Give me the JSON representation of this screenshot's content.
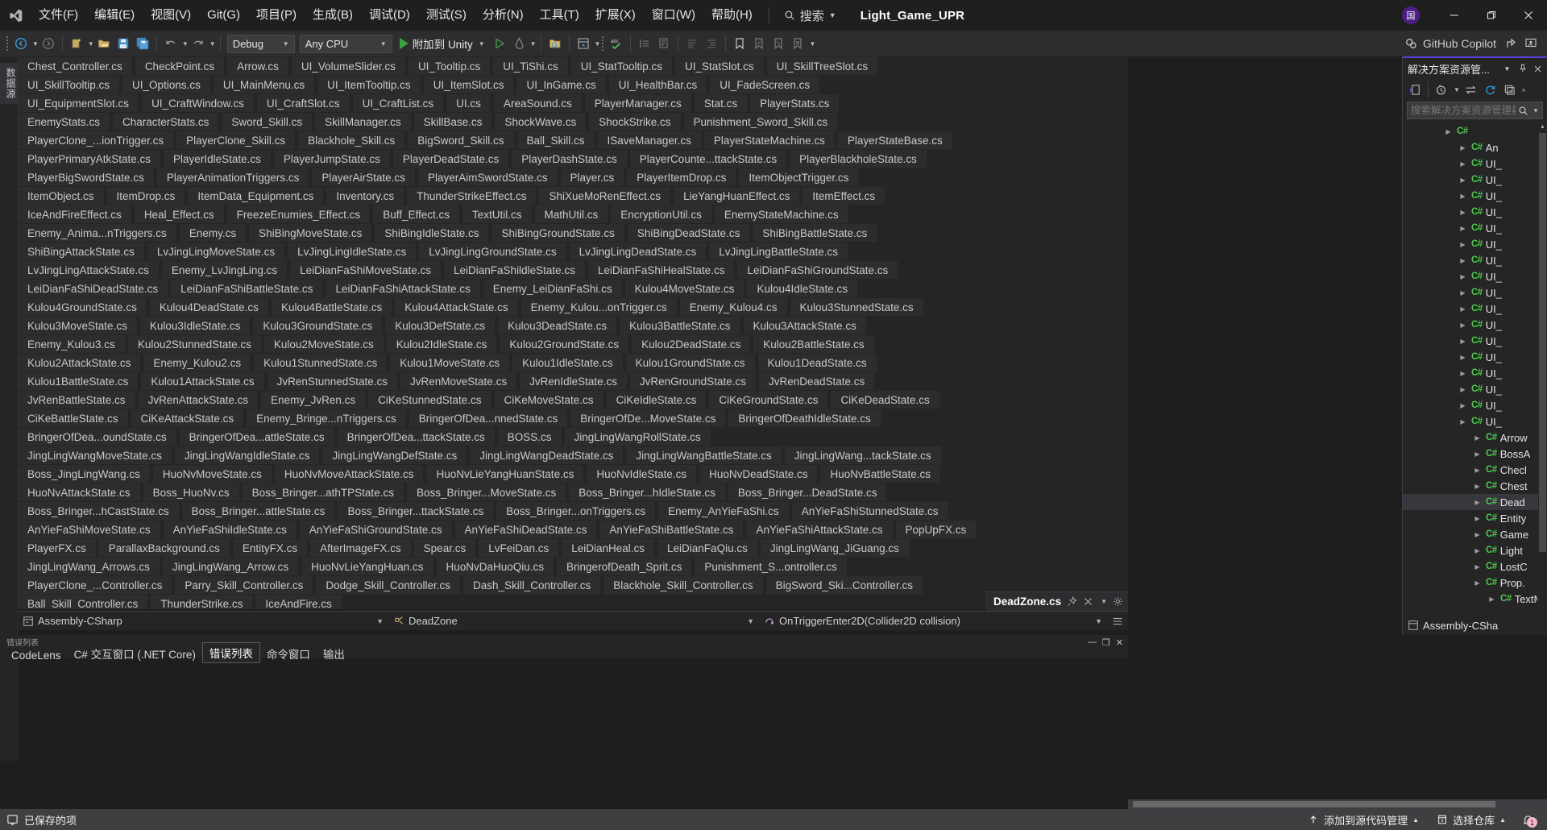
{
  "window": {
    "app": "Visual Studio",
    "solution_title": "Light_Game_UPR",
    "account_initial": "国",
    "minimize": "—",
    "restore": "❐",
    "close": "✕"
  },
  "menu": {
    "items": [
      {
        "label": "文件(F)",
        "name": "menu-file"
      },
      {
        "label": "编辑(E)",
        "name": "menu-edit"
      },
      {
        "label": "视图(V)",
        "name": "menu-view"
      },
      {
        "label": "Git(G)",
        "name": "menu-git"
      },
      {
        "label": "项目(P)",
        "name": "menu-project"
      },
      {
        "label": "生成(B)",
        "name": "menu-build"
      },
      {
        "label": "调试(D)",
        "name": "menu-debug"
      },
      {
        "label": "测试(S)",
        "name": "menu-test"
      },
      {
        "label": "分析(N)",
        "name": "menu-analyze"
      },
      {
        "label": "工具(T)",
        "name": "menu-tools"
      },
      {
        "label": "扩展(X)",
        "name": "menu-extensions"
      },
      {
        "label": "窗口(W)",
        "name": "menu-window"
      },
      {
        "label": "帮助(H)",
        "name": "menu-help"
      }
    ],
    "search_label": "搜索"
  },
  "copilot": {
    "label": "GitHub Copilot"
  },
  "toolbar": {
    "configuration": "Debug",
    "platform": "Any CPU",
    "run_label": "附加到 Unity"
  },
  "left_dock": {
    "data_sources": "数据源"
  },
  "tab_well": {
    "rows": [
      [
        "Chest_Controller.cs",
        "CheckPoint.cs",
        "Arrow.cs",
        "UI_VolumeSlider.cs",
        "UI_Tooltip.cs",
        "UI_TiShi.cs",
        "UI_StatTooltip.cs",
        "UI_StatSlot.cs",
        "UI_SkillTreeSlot.cs"
      ],
      [
        "UI_SkillTooltip.cs",
        "UI_Options.cs",
        "UI_MainMenu.cs",
        "UI_ItemTooltip.cs",
        "UI_ItemSlot.cs",
        "UI_InGame.cs",
        "UI_HealthBar.cs",
        "UI_FadeScreen.cs"
      ],
      [
        "UI_EquipmentSlot.cs",
        "UI_CraftWindow.cs",
        "UI_CraftSlot.cs",
        "UI_CraftList.cs",
        "UI.cs",
        "AreaSound.cs",
        "PlayerManager.cs",
        "Stat.cs",
        "PlayerStats.cs"
      ],
      [
        "EnemyStats.cs",
        "CharacterStats.cs",
        "Sword_Skill.cs",
        "SkillManager.cs",
        "SkillBase.cs",
        "ShockWave.cs",
        "ShockStrike.cs",
        "Punishment_Sword_Skill.cs"
      ],
      [
        "PlayerClone_...ionTrigger.cs",
        "PlayerClone_Skill.cs",
        "Blackhole_Skill.cs",
        "BigSword_Skill.cs",
        "Ball_Skill.cs",
        "ISaveManager.cs",
        "PlayerStateMachine.cs",
        "PlayerStateBase.cs"
      ],
      [
        "PlayerPrimaryAtkState.cs",
        "PlayerIdleState.cs",
        "PlayerJumpState.cs",
        "PlayerDeadState.cs",
        "PlayerDashState.cs",
        "PlayerCounte...ttackState.cs",
        "PlayerBlackholeState.cs"
      ],
      [
        "PlayerBigSwordState.cs",
        "PlayerAnimationTriggers.cs",
        "PlayerAirState.cs",
        "PlayerAimSwordState.cs",
        "Player.cs",
        "PlayerItemDrop.cs",
        "ItemObjectTrigger.cs"
      ],
      [
        "ItemObject.cs",
        "ItemDrop.cs",
        "ItemData_Equipment.cs",
        "Inventory.cs",
        "ThunderStrikeEffect.cs",
        "ShiXueMoRenEffect.cs",
        "LieYangHuanEffect.cs",
        "ItemEffect.cs"
      ],
      [
        "IceAndFireEffect.cs",
        "Heal_Effect.cs",
        "FreezeEnumies_Effect.cs",
        "Buff_Effect.cs",
        "TextUtil.cs",
        "MathUtil.cs",
        "EncryptionUtil.cs",
        "EnemyStateMachine.cs"
      ],
      [
        "Enemy_Anima...nTriggers.cs",
        "Enemy.cs",
        "ShiBingMoveState.cs",
        "ShiBingIdleState.cs",
        "ShiBingGroundState.cs",
        "ShiBingDeadState.cs",
        "ShiBingBattleState.cs"
      ],
      [
        "ShiBingAttackState.cs",
        "LvJingLingMoveState.cs",
        "LvJingLingIdleState.cs",
        "LvJingLingGroundState.cs",
        "LvJingLingDeadState.cs",
        "LvJingLingBattleState.cs"
      ],
      [
        "LvJingLingAttackState.cs",
        "Enemy_LvJingLing.cs",
        "LeiDianFaShiMoveState.cs",
        "LeiDianFaShildleState.cs",
        "LeiDianFaShiHealState.cs",
        "LeiDianFaShiGroundState.cs"
      ],
      [
        "LeiDianFaShiDeadState.cs",
        "LeiDianFaShiBattleState.cs",
        "LeiDianFaShiAttackState.cs",
        "Enemy_LeiDianFaShi.cs",
        "Kulou4MoveState.cs",
        "Kulou4IdleState.cs"
      ],
      [
        "Kulou4GroundState.cs",
        "Kulou4DeadState.cs",
        "Kulou4BattleState.cs",
        "Kulou4AttackState.cs",
        "Enemy_Kulou...onTrigger.cs",
        "Enemy_Kulou4.cs",
        "Kulou3StunnedState.cs"
      ],
      [
        "Kulou3MoveState.cs",
        "Kulou3IdleState.cs",
        "Kulou3GroundState.cs",
        "Kulou3DefState.cs",
        "Kulou3DeadState.cs",
        "Kulou3BattleState.cs",
        "Kulou3AttackState.cs"
      ],
      [
        "Enemy_Kulou3.cs",
        "Kulou2StunnedState.cs",
        "Kulou2MoveState.cs",
        "Kulou2IdleState.cs",
        "Kulou2GroundState.cs",
        "Kulou2DeadState.cs",
        "Kulou2BattleState.cs"
      ],
      [
        "Kulou2AttackState.cs",
        "Enemy_Kulou2.cs",
        "Kulou1StunnedState.cs",
        "Kulou1MoveState.cs",
        "Kulou1IdleState.cs",
        "Kulou1GroundState.cs",
        "Kulou1DeadState.cs"
      ],
      [
        "Kulou1BattleState.cs",
        "Kulou1AttackState.cs",
        "JvRenStunnedState.cs",
        "JvRenMoveState.cs",
        "JvRenIdleState.cs",
        "JvRenGroundState.cs",
        "JvRenDeadState.cs"
      ],
      [
        "JvRenBattleState.cs",
        "JvRenAttackState.cs",
        "Enemy_JvRen.cs",
        "CiKeStunnedState.cs",
        "CiKeMoveState.cs",
        "CiKeIdleState.cs",
        "CiKeGroundState.cs",
        "CiKeDeadState.cs"
      ],
      [
        "CiKeBattleState.cs",
        "CiKeAttackState.cs",
        "Enemy_Bringe...nTriggers.cs",
        "BringerOfDea...nnedState.cs",
        "BringerOfDe...MoveState.cs",
        "BringerOfDeathIdleState.cs"
      ],
      [
        "BringerOfDea...oundState.cs",
        "BringerOfDea...attleState.cs",
        "BringerOfDea...ttackState.cs",
        "BOSS.cs",
        "JingLingWangRollState.cs"
      ],
      [
        "JingLingWangMoveState.cs",
        "JingLingWangIdleState.cs",
        "JingLingWangDefState.cs",
        "JingLingWangDeadState.cs",
        "JingLingWangBattleState.cs",
        "JingLingWang...tackState.cs"
      ],
      [
        "Boss_JingLingWang.cs",
        "HuoNvMoveState.cs",
        "HuoNvMoveAttackState.cs",
        "HuoNvLieYangHuanState.cs",
        "HuoNvIdleState.cs",
        "HuoNvDeadState.cs",
        "HuoNvBattleState.cs"
      ],
      [
        "HuoNvAttackState.cs",
        "Boss_HuoNv.cs",
        "Boss_Bringer...athTPState.cs",
        "Boss_Bringer...MoveState.cs",
        "Boss_Bringer...hIdleState.cs",
        "Boss_Bringer...DeadState.cs"
      ],
      [
        "Boss_Bringer...hCastState.cs",
        "Boss_Bringer...attleState.cs",
        "Boss_Bringer...ttackState.cs",
        "Boss_Bringer...onTriggers.cs",
        "Enemy_AnYieFaShi.cs",
        "AnYieFaShiStunnedState.cs"
      ],
      [
        "AnYieFaShiMoveState.cs",
        "AnYieFaShiIdleState.cs",
        "AnYieFaShiGroundState.cs",
        "AnYieFaShiDeadState.cs",
        "AnYieFaShiBattleState.cs",
        "AnYieFaShiAttackState.cs",
        "PopUpFX.cs"
      ],
      [
        "PlayerFX.cs",
        "ParallaxBackground.cs",
        "EntityFX.cs",
        "AfterImageFX.cs",
        "Spear.cs",
        "LvFeiDan.cs",
        "LeiDianHeal.cs",
        "LeiDianFaQiu.cs",
        "JingLingWang_JiGuang.cs"
      ],
      [
        "JingLingWang_Arrows.cs",
        "JingLingWang_Arrow.cs",
        "HuoNvLieYangHuan.cs",
        "HuoNvDaHuoQiu.cs",
        "BringerofDeath_Sprit.cs",
        "Punishment_S...ontroller.cs"
      ],
      [
        "PlayerClone_...Controller.cs",
        "Parry_Skill_Controller.cs",
        "Dodge_Skill_Controller.cs",
        "Dash_Skill_Controller.cs",
        "Blackhole_Skill_Controller.cs",
        "BigSword_Ski...Controller.cs"
      ],
      [
        "Ball_Skill_Controller.cs",
        "ThunderStrike.cs",
        "IceAndFire.cs"
      ]
    ]
  },
  "document": {
    "active_tab": "DeadZone.cs",
    "project": "Assembly-CSharp",
    "type": "DeadZone",
    "member": "OnTriggerEnter2D(Collider2D collision)"
  },
  "solution_explorer": {
    "title": "解决方案资源管...",
    "search_placeholder": "搜索解决方案资源管理器",
    "footer": "Assembly-CSha",
    "tree": [
      {
        "label": "",
        "indent": 2,
        "selected": false
      },
      {
        "label": "An",
        "indent": 1,
        "selected": false
      },
      {
        "label": "UI_",
        "indent": 1,
        "selected": false
      },
      {
        "label": "UI_",
        "indent": 1,
        "selected": false
      },
      {
        "label": "UI_",
        "indent": 1,
        "selected": false
      },
      {
        "label": "UI_",
        "indent": 1,
        "selected": false
      },
      {
        "label": "UI_",
        "indent": 1,
        "selected": false
      },
      {
        "label": "UI_",
        "indent": 1,
        "selected": false
      },
      {
        "label": "UI_",
        "indent": 1,
        "selected": false
      },
      {
        "label": "UI_",
        "indent": 1,
        "selected": false
      },
      {
        "label": "UI_",
        "indent": 1,
        "selected": false
      },
      {
        "label": "UI_",
        "indent": 1,
        "selected": false
      },
      {
        "label": "UI_",
        "indent": 1,
        "selected": false
      },
      {
        "label": "UI_",
        "indent": 1,
        "selected": false
      },
      {
        "label": "UI_",
        "indent": 1,
        "selected": false
      },
      {
        "label": "UI_",
        "indent": 1,
        "selected": false
      },
      {
        "label": "UI_",
        "indent": 1,
        "selected": false
      },
      {
        "label": "UI_",
        "indent": 1,
        "selected": false
      },
      {
        "label": "UI_",
        "indent": 1,
        "selected": false
      },
      {
        "label": "Arrow",
        "indent": 0,
        "selected": false
      },
      {
        "label": "BossA",
        "indent": 0,
        "selected": false
      },
      {
        "label": "Checl",
        "indent": 0,
        "selected": false
      },
      {
        "label": "Chest",
        "indent": 0,
        "selected": false
      },
      {
        "label": "Dead",
        "indent": 0,
        "selected": true
      },
      {
        "label": "Entity",
        "indent": 0,
        "selected": false
      },
      {
        "label": "Game",
        "indent": 0,
        "selected": false
      },
      {
        "label": "Light",
        "indent": 0,
        "selected": false
      },
      {
        "label": "LostC",
        "indent": 0,
        "selected": false
      },
      {
        "label": "Prop.",
        "indent": 0,
        "selected": false
      },
      {
        "label": "TextMes",
        "indent": -1,
        "selected": false
      }
    ]
  },
  "bottom_panel": {
    "caption": "错误列表",
    "tabs": [
      {
        "label": "CodeLens",
        "active": false
      },
      {
        "label": "C# 交互窗口 (.NET Core)",
        "active": false
      },
      {
        "label": "错误列表",
        "active": true
      },
      {
        "label": "命令窗口",
        "active": false
      },
      {
        "label": "输出",
        "active": false
      }
    ]
  },
  "status_bar": {
    "message": "已保存的项",
    "source_control": "添加到源代码管理",
    "repository": "选择仓库",
    "notification_count": "1"
  },
  "colors": {
    "accent_purple": "#5b3fd4",
    "tab_bg": "#2d2d30",
    "panel_bg": "#252526",
    "status_bg": "#3f3f41",
    "cs_green": "#4ec94e",
    "play_green": "#3fa13f"
  }
}
